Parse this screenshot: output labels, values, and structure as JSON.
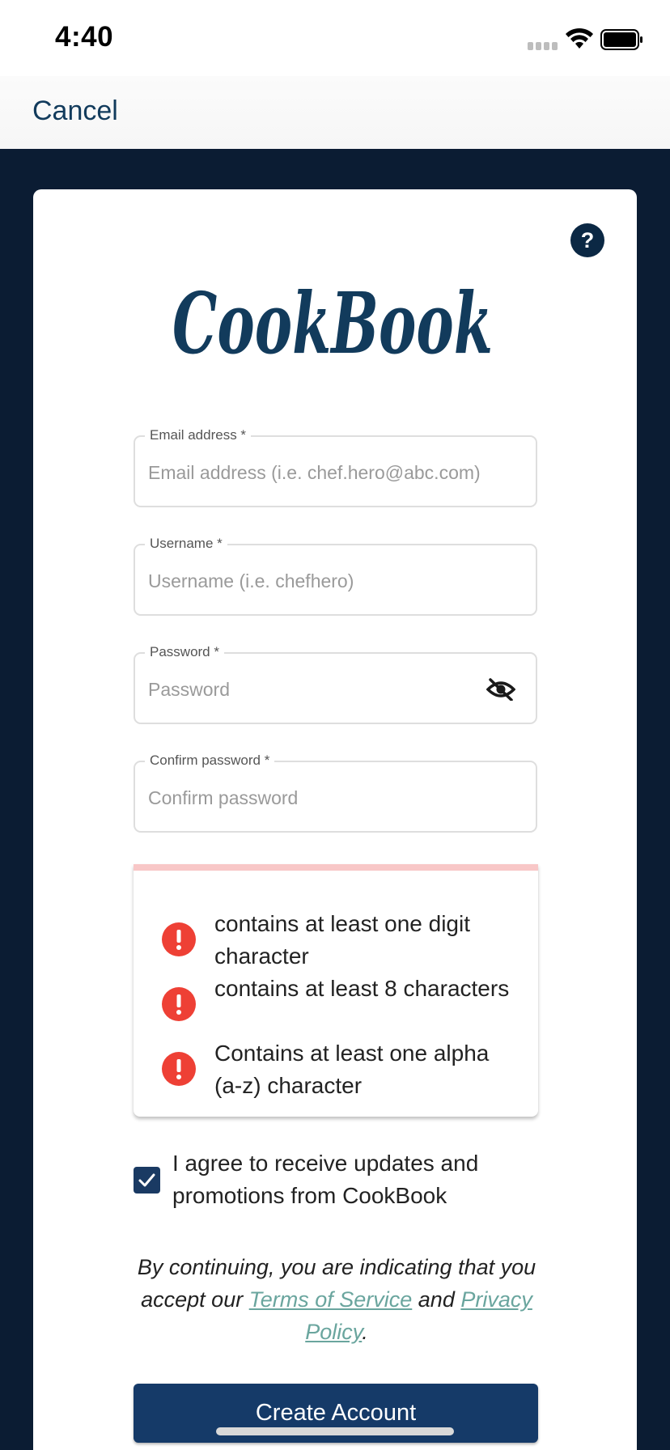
{
  "status": {
    "time": "4:40",
    "icons": [
      "signal-icon",
      "wifi-icon",
      "battery-icon"
    ]
  },
  "nav": {
    "cancel_label": "Cancel"
  },
  "brand": {
    "logo_text": "CookBook",
    "logo_color": "#123b5c"
  },
  "form": {
    "email": {
      "label": "Email address *",
      "placeholder": "Email address (i.e. chef.hero@abc.com)",
      "value": ""
    },
    "username": {
      "label": "Username *",
      "placeholder": "Username (i.e. chefhero)",
      "value": ""
    },
    "password": {
      "label": "Password *",
      "placeholder": "Password",
      "value": "",
      "toggle_icon": "eye-off-icon"
    },
    "confirm": {
      "label": "Confirm password *",
      "placeholder": "Confirm password",
      "value": ""
    }
  },
  "requirements": [
    {
      "text": "contains at least one digit character",
      "status": "error",
      "icon": "alert-icon"
    },
    {
      "text": "contains at least 8 characters",
      "status": "error",
      "icon": "alert-icon"
    },
    {
      "text": "Contains at least one alpha (a-z) character",
      "status": "error",
      "icon": "alert-icon"
    }
  ],
  "agree": {
    "checked": true,
    "text": "I agree to receive updates and promotions from CookBook"
  },
  "legal": {
    "prefix": "By continuing, you are indicating that you accept our ",
    "terms_link": "Terms of Service",
    "middle": " and ",
    "privacy_link": "Privacy Policy",
    "suffix": "."
  },
  "submit_label": "Create Account",
  "colors": {
    "background": "#0b1c33",
    "primary": "#153a68",
    "link": "#6aa59e",
    "error": "#ee4035",
    "error_bar": "#f8c7c7"
  }
}
